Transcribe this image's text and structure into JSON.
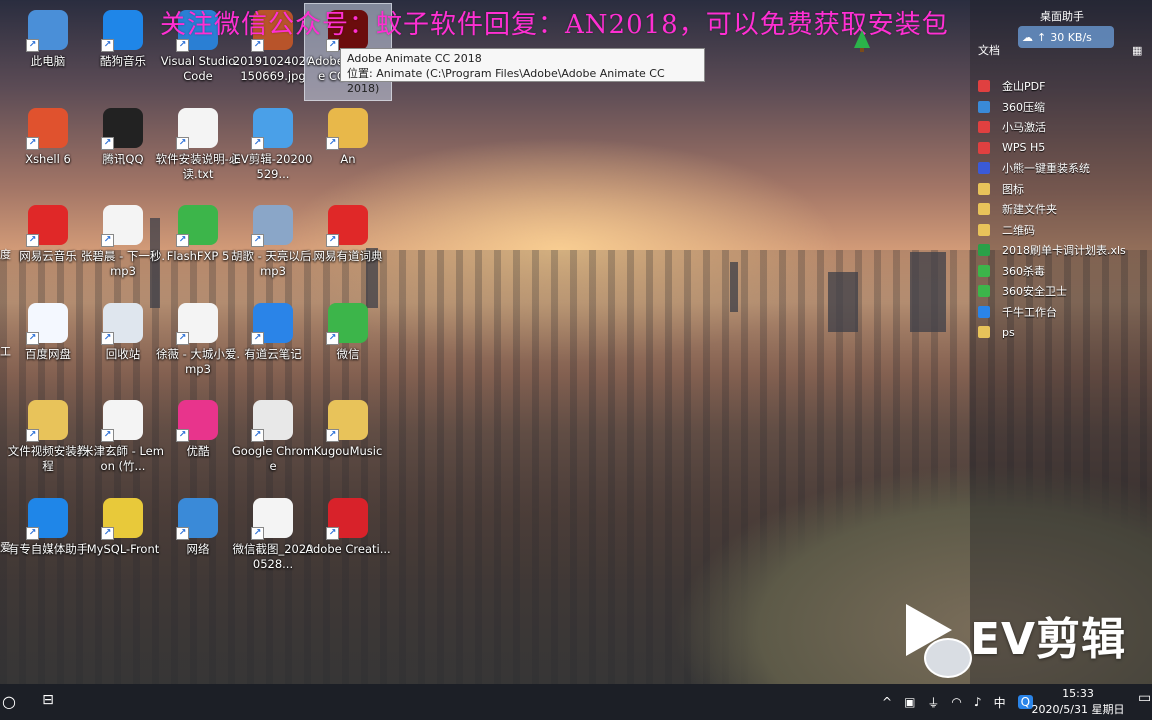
{
  "watermark_top": "关注微信公众号：蚊子软件回复：AN2018，可以免费获取安装包",
  "tooltip": {
    "line1": "Adobe Animate CC 2018",
    "line2": "位置: Animate (C:\\Program Files\\Adobe\\Adobe Animate CC 2018)"
  },
  "desktop_icons": [
    {
      "label": "此电脑",
      "icon": "computer-icon",
      "color": "#4a8fd8"
    },
    {
      "label": "酷狗音乐",
      "icon": "kugou-icon",
      "color": "#1f86e8"
    },
    {
      "label": "Visual Studio Code",
      "icon": "vscode-icon",
      "color": "#2a7fd4"
    },
    {
      "label": "20191024020150669.jpg",
      "icon": "image-icon",
      "color": "#b8542a"
    },
    {
      "label": "Adobe Animate CC 2018",
      "icon": "animate-icon",
      "color": "#6b0d0d"
    },
    {
      "label": "Xshell 6",
      "icon": "xshell-icon",
      "color": "#e0522e"
    },
    {
      "label": "腾讯QQ",
      "icon": "qq-icon",
      "color": "#222222"
    },
    {
      "label": "软件安装说明-必读.txt",
      "icon": "text-file-icon",
      "color": "#f4f4f4"
    },
    {
      "label": "EV剪辑-20200529...",
      "icon": "ev-video-icon",
      "color": "#4aa0e8"
    },
    {
      "label": "An",
      "icon": "zip-icon",
      "color": "#e8b84a"
    },
    {
      "label": "网易云音乐",
      "icon": "netease-music-icon",
      "color": "#e02828"
    },
    {
      "label": "张碧晨 - 下一秒.mp3",
      "icon": "mp3-icon",
      "color": "#f4f4f4"
    },
    {
      "label": "FlashFXP 5",
      "icon": "flashfxp-icon",
      "color": "#3cb54a"
    },
    {
      "label": "胡歌 - 天亮以后.mp3",
      "icon": "album-icon",
      "color": "#8aa6c8"
    },
    {
      "label": "网易有道词典",
      "icon": "youdao-dict-icon",
      "color": "#e02828"
    },
    {
      "label": "百度网盘",
      "icon": "baidu-netdisk-icon",
      "color": "#f4f8ff"
    },
    {
      "label": "回收站",
      "icon": "recycle-bin-icon",
      "color": "#dfe6ee"
    },
    {
      "label": "徐薇 - 大城小爱.mp3",
      "icon": "mp3-icon",
      "color": "#f4f4f4"
    },
    {
      "label": "有道云笔记",
      "icon": "youdao-note-icon",
      "color": "#2a84e8"
    },
    {
      "label": "微信",
      "icon": "wechat-icon",
      "color": "#3cb54a"
    },
    {
      "label": "文件视频安装教程",
      "icon": "folder-icon",
      "color": "#e8c35a"
    },
    {
      "label": "米津玄師 - Lemon (竹...",
      "icon": "mp3-icon",
      "color": "#f4f4f4"
    },
    {
      "label": "优酷",
      "icon": "youku-icon",
      "color": "#e8348c"
    },
    {
      "label": "Google Chrome",
      "icon": "chrome-icon",
      "color": "#e8e8e8"
    },
    {
      "label": "KugouMusic",
      "icon": "folder-icon",
      "color": "#e8c35a"
    },
    {
      "label": "有专自媒体助手",
      "icon": "media-helper-icon",
      "color": "#1f86e8"
    },
    {
      "label": "MySQL-Front",
      "icon": "mysql-front-icon",
      "color": "#e8c93a"
    },
    {
      "label": "网络",
      "icon": "network-icon",
      "color": "#3a8ad8"
    },
    {
      "label": "微信截图_20200528...",
      "icon": "screenshot-icon",
      "color": "#f4f4f4"
    },
    {
      "label": "Adobe Creati...",
      "icon": "creative-cloud-icon",
      "color": "#d8222a"
    }
  ],
  "partial_left_labels": [
    "度",
    "工",
    "爱"
  ],
  "right_panel": {
    "title": "桌面助手",
    "doc_label": "文档",
    "net_speed": "30 KB/s",
    "items": [
      {
        "label": "金山PDF",
        "color": "#e04040"
      },
      {
        "label": "360压缩",
        "color": "#3a8ad8"
      },
      {
        "label": "小马激活",
        "color": "#e04040"
      },
      {
        "label": "WPS H5",
        "color": "#e04040"
      },
      {
        "label": "小熊一键重装系统",
        "color": "#3a5ad8"
      },
      {
        "label": "图标",
        "color": "#e8c35a"
      },
      {
        "label": "新建文件夹",
        "color": "#e8c35a"
      },
      {
        "label": "二维码",
        "color": "#e8c35a"
      },
      {
        "label": "2018刷单卡调计划表.xls",
        "color": "#2aa048"
      },
      {
        "label": "360杀毒",
        "color": "#3cb54a"
      },
      {
        "label": "360安全卫士",
        "color": "#3cb54a"
      },
      {
        "label": "千牛工作台",
        "color": "#2a84e8"
      },
      {
        "label": "ps",
        "color": "#e8c35a"
      }
    ]
  },
  "ev_watermark": "EV剪辑",
  "taskbar": {
    "time": "15:33",
    "date": "2020/5/31 星期日",
    "ime": "中",
    "tray_chevron": "^"
  }
}
